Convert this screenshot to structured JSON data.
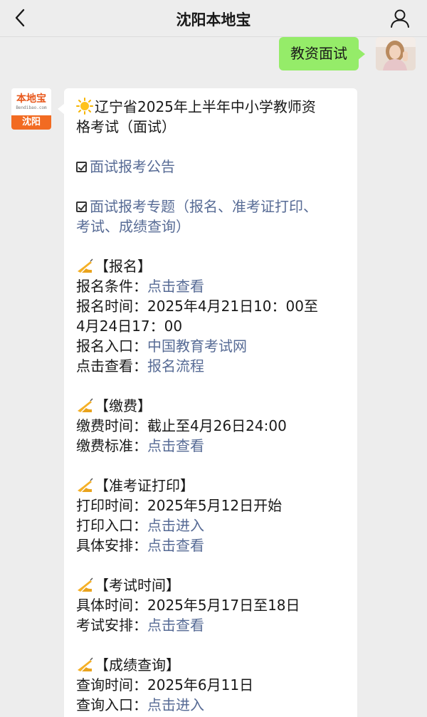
{
  "header": {
    "title": "沈阳本地宝",
    "back_icon": "chevron-left-icon",
    "profile_icon": "person-icon"
  },
  "outgoing": {
    "text": "教资面试"
  },
  "bot": {
    "logo_main": "本地宝",
    "logo_sub": "Bendibao.com",
    "logo_city": "沈阳"
  },
  "message": {
    "headline_line1": "辽宁省2025年上半年中小学教师资",
    "headline_line2": "格考试（面试）",
    "notice_link": "面试报考公告",
    "topic_link_line1": "面试报考专题（报名、准考证打印、",
    "topic_link_line2": "考试、成绩查询）",
    "sections": {
      "signup": {
        "heading": "【报名】",
        "cond_label": "报名条件：",
        "cond_link": "点击查看",
        "time_line1": "报名时间：2025年4月21日10：00至",
        "time_line2": "4月24日17：00",
        "entry_label": "报名入口：",
        "entry_link": "中国教育考试网",
        "flow_label": "点击查看：",
        "flow_link": "报名流程"
      },
      "fee": {
        "heading": "【缴费】",
        "time": "缴费时间：截止至4月26日24:00",
        "std_label": "缴费标准：",
        "std_link": "点击查看"
      },
      "admit": {
        "heading": "【准考证打印】",
        "time": "打印时间：2025年5月12日开始",
        "entry_label": "打印入口：",
        "entry_link": "点击进入",
        "plan_label": "具体安排：",
        "plan_link": "点击查看"
      },
      "exam": {
        "heading": "【考试时间】",
        "time": "具体时间：2025年5月17日至18日",
        "plan_label": "考试安排：",
        "plan_link": "点击查看"
      },
      "score": {
        "heading": "【成绩查询】",
        "time": "查询时间：2025年6月11日",
        "entry_label": "查询入口：",
        "entry_link": "点击进入"
      }
    }
  },
  "colors": {
    "bubble_out": "#95ec69",
    "link": "#576b95",
    "brand": "#f26b22"
  }
}
